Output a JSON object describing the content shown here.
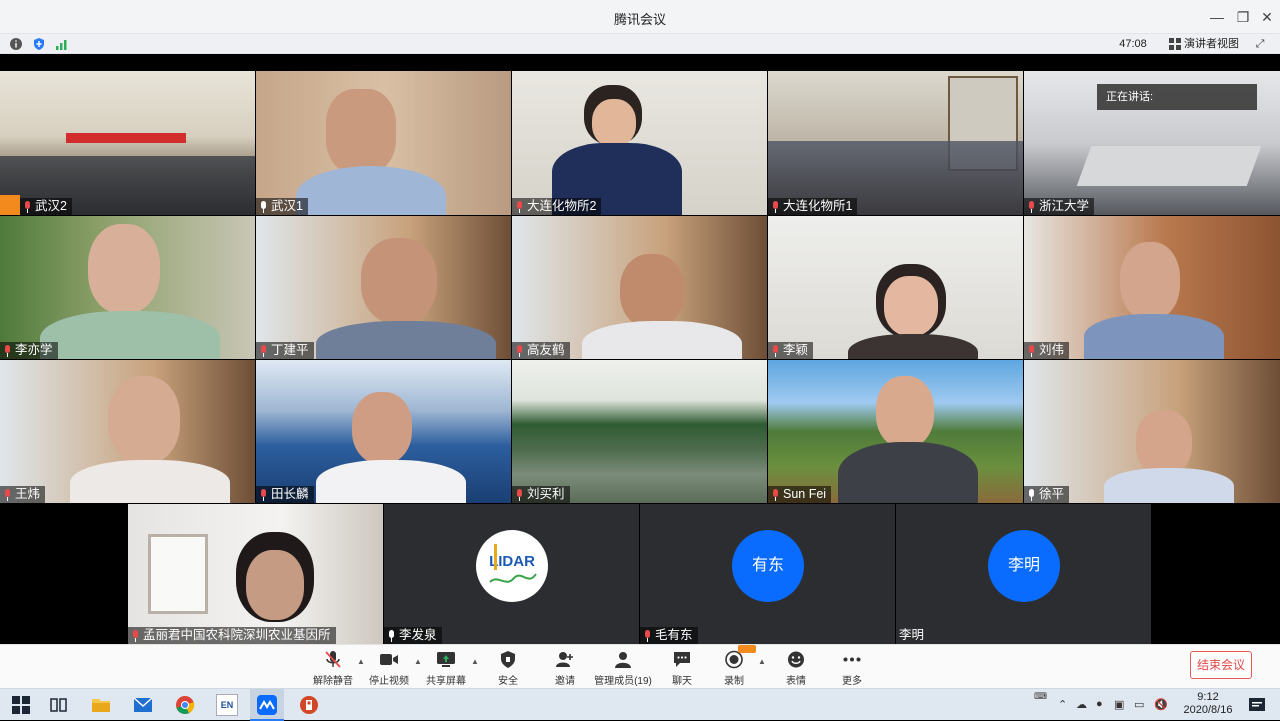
{
  "window": {
    "title": "腾讯会议"
  },
  "infobar": {
    "timer": "47:08",
    "speaker_view_label": "演讲者视图"
  },
  "speaking": {
    "label": "正在讲话:"
  },
  "participants": [
    {
      "name": "武汉2",
      "muted": true
    },
    {
      "name": "武汉1",
      "muted": false
    },
    {
      "name": "大连化物所2",
      "muted": true
    },
    {
      "name": "大连化物所1",
      "muted": true
    },
    {
      "name": "浙江大学",
      "muted": true
    },
    {
      "name": "李亦学",
      "muted": true
    },
    {
      "name": "丁建平",
      "muted": true
    },
    {
      "name": "高友鹤",
      "muted": true
    },
    {
      "name": "李颖",
      "muted": true
    },
    {
      "name": "刘伟",
      "muted": true
    },
    {
      "name": "王炜",
      "muted": true
    },
    {
      "name": "田长麟",
      "muted": true
    },
    {
      "name": "刘买利",
      "muted": true
    },
    {
      "name": "Sun Fei",
      "muted": true
    },
    {
      "name": "徐平",
      "muted": false
    },
    {
      "name": "孟丽君中国农科院深圳农业基因所",
      "muted": true
    },
    {
      "name": "李发泉",
      "muted": false,
      "logo_text": "LIDAR"
    },
    {
      "name": "毛有东",
      "muted": true,
      "avatar_text": "有东"
    },
    {
      "name": "李明",
      "muted": false,
      "avatar_text": "李明"
    }
  ],
  "toolbar": {
    "mute": "解除静音",
    "video": "停止视频",
    "share": "共享屏幕",
    "security": "安全",
    "invite": "邀请",
    "members": "管理成员(19)",
    "chat": "聊天",
    "record": "录制",
    "reactions": "表情",
    "more": "更多",
    "end": "结束会议"
  },
  "taskbar": {
    "time": "9:12",
    "date": "2020/8/16",
    "lang_badge": "EN"
  },
  "colors": {
    "accent": "#0a6cff",
    "end_red": "#e04848",
    "muted_red": "#e94949"
  }
}
